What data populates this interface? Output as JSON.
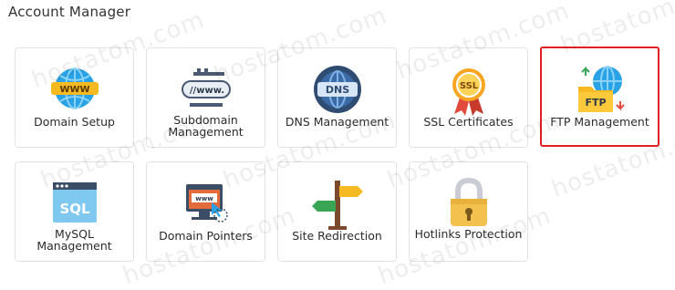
{
  "section": {
    "title": "Account Manager"
  },
  "tiles": [
    {
      "label": "Domain Setup",
      "icon": "www-globe-icon"
    },
    {
      "label": "Subdomain Management",
      "icon": "subdomain-link-icon"
    },
    {
      "label": "DNS Management",
      "icon": "dns-globe-icon"
    },
    {
      "label": "SSL Certificates",
      "icon": "ssl-badge-icon"
    },
    {
      "label": "FTP Management",
      "icon": "ftp-folder-icon"
    },
    {
      "label": "MySQL Management",
      "icon": "sql-database-icon"
    },
    {
      "label": "Domain Pointers",
      "icon": "domain-pointer-icon"
    },
    {
      "label": "Site Redirection",
      "icon": "signpost-icon"
    },
    {
      "label": "Hotlinks Protection",
      "icon": "padlock-icon"
    }
  ],
  "selected_tile": "FTP Management",
  "watermark": "hostatom.com",
  "colors": {
    "selected_border": "#e02020",
    "tile_border": "#e3e3e3"
  }
}
